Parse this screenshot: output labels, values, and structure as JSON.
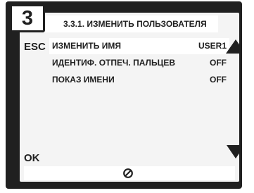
{
  "step_number": "3",
  "title": "3.3.1. ИЗМЕНИТЬ ПОЛЬЗОВАТЕЛЯ",
  "esc_label": "ESC",
  "ok_label": "OK",
  "menu": {
    "items": [
      {
        "label": "ИЗМЕНИТЬ ИМЯ",
        "value": "USER1",
        "selected": true
      },
      {
        "label": "ИДЕНТИФ. ОТПЕЧ. ПАЛЬЦЕВ",
        "value": "OFF",
        "selected": false
      },
      {
        "label": "ПОКАЗ ИМЕНИ",
        "value": "OFF",
        "selected": false
      }
    ]
  },
  "icons": {
    "scroll_up": "triangle-up-icon",
    "scroll_down": "triangle-down-icon",
    "status": "disabled-circle-icon"
  },
  "colors": {
    "frame": "#202020",
    "screen": "#f4f4f4",
    "highlight": "#ffffff"
  }
}
